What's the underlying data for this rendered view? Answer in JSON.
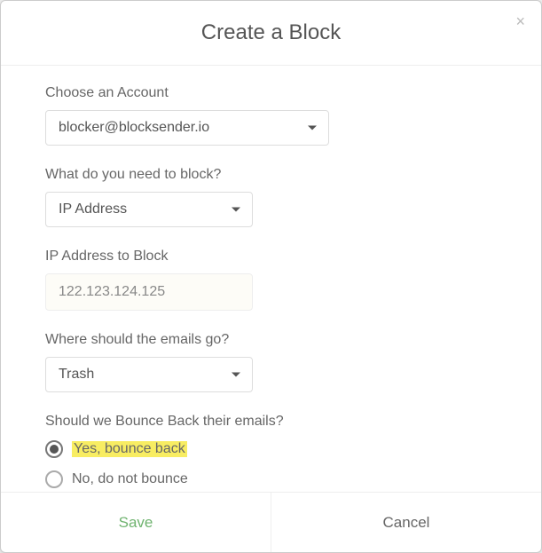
{
  "modal": {
    "title": "Create a Block",
    "close": "×"
  },
  "form": {
    "account": {
      "label": "Choose an Account",
      "value": "blocker@blocksender.io"
    },
    "block_type": {
      "label": "What do you need to block?",
      "value": "IP Address"
    },
    "ip": {
      "label": "IP Address to Block",
      "value": "122.123.124.125"
    },
    "destination": {
      "label": "Where should the emails go?",
      "value": "Trash"
    },
    "bounce": {
      "label": "Should we Bounce Back their emails?",
      "yes": "Yes, bounce back",
      "no": "No, do not bounce"
    }
  },
  "footer": {
    "save": "Save",
    "cancel": "Cancel"
  }
}
